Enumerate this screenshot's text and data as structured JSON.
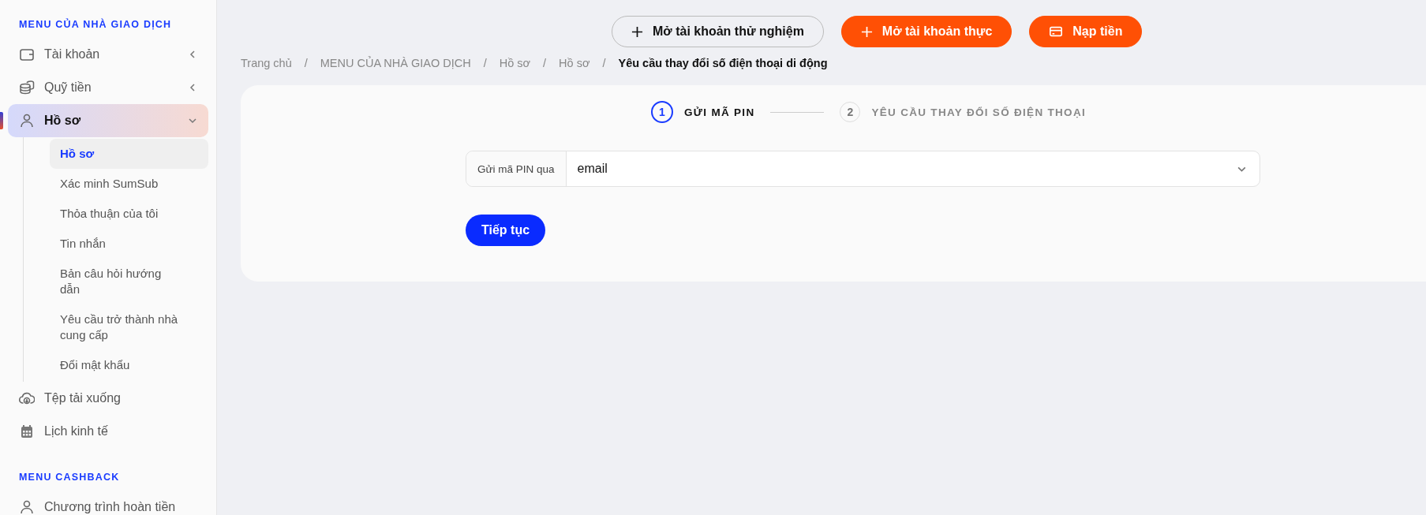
{
  "sidebar": {
    "sections": [
      {
        "title": "MENU CỦA NHÀ GIAO DỊCH",
        "items": [
          {
            "label": "Tài khoản",
            "kind": "group",
            "expanded": false,
            "selected": false
          },
          {
            "label": "Quỹ tiền",
            "kind": "group",
            "expanded": false,
            "selected": false
          },
          {
            "label": "Hồ sơ",
            "kind": "group",
            "expanded": true,
            "selected": true,
            "children": [
              {
                "label": "Hồ sơ",
                "selected": true
              },
              {
                "label": "Xác minh SumSub",
                "selected": false
              },
              {
                "label": "Thỏa thuận của tôi",
                "selected": false
              },
              {
                "label": "Tin nhắn",
                "selected": false
              },
              {
                "label": "Bản câu hỏi hướng dẫn",
                "selected": false
              },
              {
                "label": "Yêu cầu trở thành nhà cung cấp",
                "selected": false
              },
              {
                "label": "Đổi mật khẩu",
                "selected": false
              }
            ]
          },
          {
            "label": "Tệp tải xuống",
            "kind": "link",
            "selected": false
          },
          {
            "label": "Lịch kinh tế",
            "kind": "link",
            "selected": false
          }
        ]
      },
      {
        "title": "MENU CASHBACK",
        "items": [
          {
            "label": "Chương trình hoàn tiền",
            "kind": "link",
            "selected": false
          }
        ]
      }
    ]
  },
  "header_buttons": [
    {
      "label": "Mở tài khoản thử nghiệm",
      "kind": "outline"
    },
    {
      "label": "Mở tài khoản thực",
      "kind": "primary"
    },
    {
      "label": "Nạp tiền",
      "kind": "primary"
    }
  ],
  "breadcrumb": {
    "separator": "/",
    "items": [
      "Trang chủ",
      "MENU CỦA NHÀ GIAO DỊCH",
      "Hồ sơ",
      "Hồ sơ",
      "Yêu cầu thay đổi số điện thoại di động"
    ]
  },
  "stepper": [
    {
      "number": "1",
      "label": "GỬI MÃ PIN",
      "selected": true
    },
    {
      "number": "2",
      "label": "YÊU CẦU THAY ĐỔI SỐ ĐIỆN THOẠI",
      "selected": false
    }
  ],
  "form": {
    "label": "Gửi mã PIN qua",
    "value": "email",
    "submit": "Tiếp tục"
  }
}
